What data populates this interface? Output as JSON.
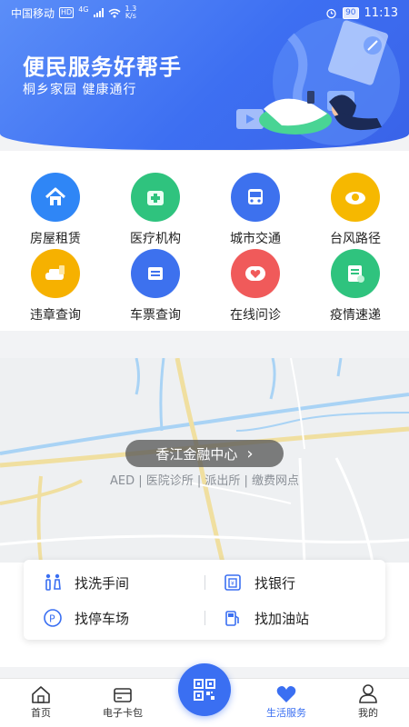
{
  "status_bar": {
    "carrier": "中国移动",
    "hd": "HD",
    "network": "4G",
    "speed": "1.3\nK/s",
    "battery": "90",
    "time": "11:13"
  },
  "banner": {
    "title": "便民服务好帮手",
    "subtitle": "桐乡家园 健康通行"
  },
  "services": [
    {
      "label": "房屋租赁",
      "icon": "house-icon",
      "color": "#2f86f6"
    },
    {
      "label": "医疗机构",
      "icon": "medical-icon",
      "color": "#2fc37e"
    },
    {
      "label": "城市交通",
      "icon": "bus-icon",
      "color": "#3d71ee"
    },
    {
      "label": "台风路径",
      "icon": "typhoon-icon",
      "color": "#f6b800"
    },
    {
      "label": "违章查询",
      "icon": "violation-icon",
      "color": "#f6b100"
    },
    {
      "label": "车票查询",
      "icon": "ticket-icon",
      "color": "#3d71ee"
    },
    {
      "label": "在线问诊",
      "icon": "heart-consult-icon",
      "color": "#f05a5a"
    },
    {
      "label": "疫情速递",
      "icon": "epidemic-news-icon",
      "color": "#2fc37e"
    }
  ],
  "map": {
    "location": "香江金融中心",
    "chevron": "›",
    "poi_text": "AED | 医院诊所 | 派出所 | 缴费网点"
  },
  "finder": {
    "items": [
      {
        "label": "找洗手间",
        "icon": "restroom-icon"
      },
      {
        "label": "找银行",
        "icon": "bank-icon"
      },
      {
        "label": "找停车场",
        "icon": "parking-icon"
      },
      {
        "label": "找加油站",
        "icon": "gas-station-icon"
      }
    ]
  },
  "tabbar": {
    "tabs": [
      {
        "label": "首页",
        "icon": "home-icon"
      },
      {
        "label": "电子卡包",
        "icon": "wallet-icon"
      },
      {
        "label": "生活服务",
        "icon": "heart-icon"
      },
      {
        "label": "我的",
        "icon": "user-icon"
      }
    ],
    "center_icon": "qr-code-icon",
    "active_color": "#3a6ff2"
  },
  "colors": {
    "brand_blue": "#3a6ff2"
  }
}
